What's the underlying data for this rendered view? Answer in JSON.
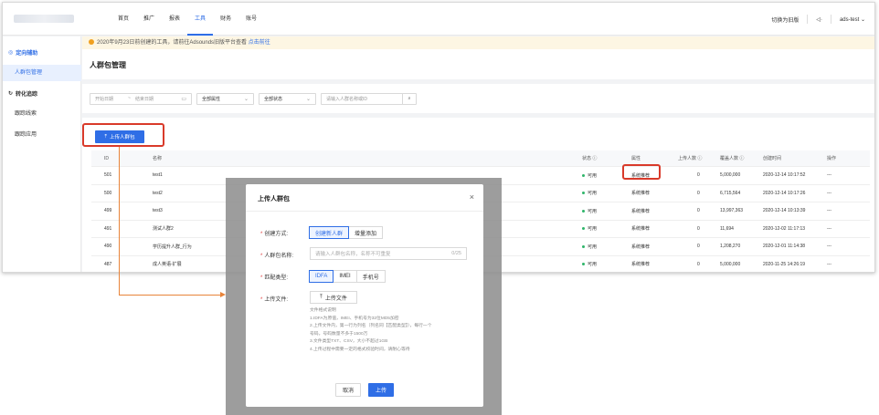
{
  "topnav": [
    "首页",
    "推广",
    "报表",
    "工具",
    "财务",
    "账号"
  ],
  "topnav_active": 3,
  "topright": {
    "switch": "切换为旧版",
    "sound_icon": "speaker-icon",
    "user": "ads-test"
  },
  "sidebar": {
    "group1": "定向辅助",
    "item1": "人群包管理",
    "group2": "转化追踪",
    "item2": "跟踪线索",
    "item3": "跟踪应用"
  },
  "notice": {
    "text": "2020年9月23日前创建的工具，请前往Adsounds旧版平台查看",
    "link": "点击前往"
  },
  "page_title": "人群包管理",
  "filters": {
    "start": "开始日期",
    "tilde": "~",
    "end": "结束日期",
    "attr": "全部属性",
    "status": "全部状态",
    "search_placeholder": "请输入人群名称或ID"
  },
  "upload_button": "上传人群包",
  "table": {
    "headers": [
      "ID",
      "名称",
      "状态 ⓘ",
      "属性",
      "上传人数 ⓘ",
      "覆盖人数 ⓘ",
      "创建时间",
      "操作"
    ],
    "rows": [
      [
        "501",
        "test1",
        "可用",
        "系统推荐",
        "0",
        "5,000,000",
        "2020-12-14 10:17:52",
        "---"
      ],
      [
        "500",
        "test2",
        "可用",
        "系统推荐",
        "0",
        "6,715,564",
        "2020-12-14 10:17:26",
        "---"
      ],
      [
        "499",
        "test3",
        "可用",
        "系统推荐",
        "0",
        "13,997,363",
        "2020-12-14 10:13:39",
        "---"
      ],
      [
        "491",
        "测试人群2",
        "可用",
        "系统推荐",
        "0",
        "11,694",
        "2020-12-02 11:17:13",
        "---"
      ],
      [
        "490",
        "学历提升人群_行为",
        "可用",
        "系统推荐",
        "0",
        "1,208,270",
        "2020-12-01 11:14:38",
        "---"
      ],
      [
        "487",
        "成人英语-扩展",
        "可用",
        "系统推荐",
        "0",
        "5,000,000",
        "2020-11-25 14:26:19",
        "---"
      ]
    ]
  },
  "modal": {
    "title": "上传人群包",
    "create_label": "创建方式:",
    "create_opts": [
      "创建新人群",
      "增量添加"
    ],
    "name_label": "人群包名称:",
    "name_placeholder": "请输入人群包名称，名称不可重复",
    "name_count": "0/25",
    "match_label": "匹配类型:",
    "match_opts": [
      "IDFA",
      "IMEI",
      "手机号"
    ],
    "file_label": "上传文件:",
    "file_button": "上传文件",
    "hints": [
      "文件格式说明",
      "1.IDFA为原值，IMEI、手机号为32位MD5加密",
      "2.上传文件内，第一行为列名（列名同【匹配类型】），每行一个",
      "号码，号码数量不多于1500万",
      "3.文件类型TXT、CSV，大小不超过1GB",
      "4.上传过程中需要一定的格式校验时间，请耐心等待"
    ],
    "cancel": "取消",
    "ok": "上传"
  }
}
